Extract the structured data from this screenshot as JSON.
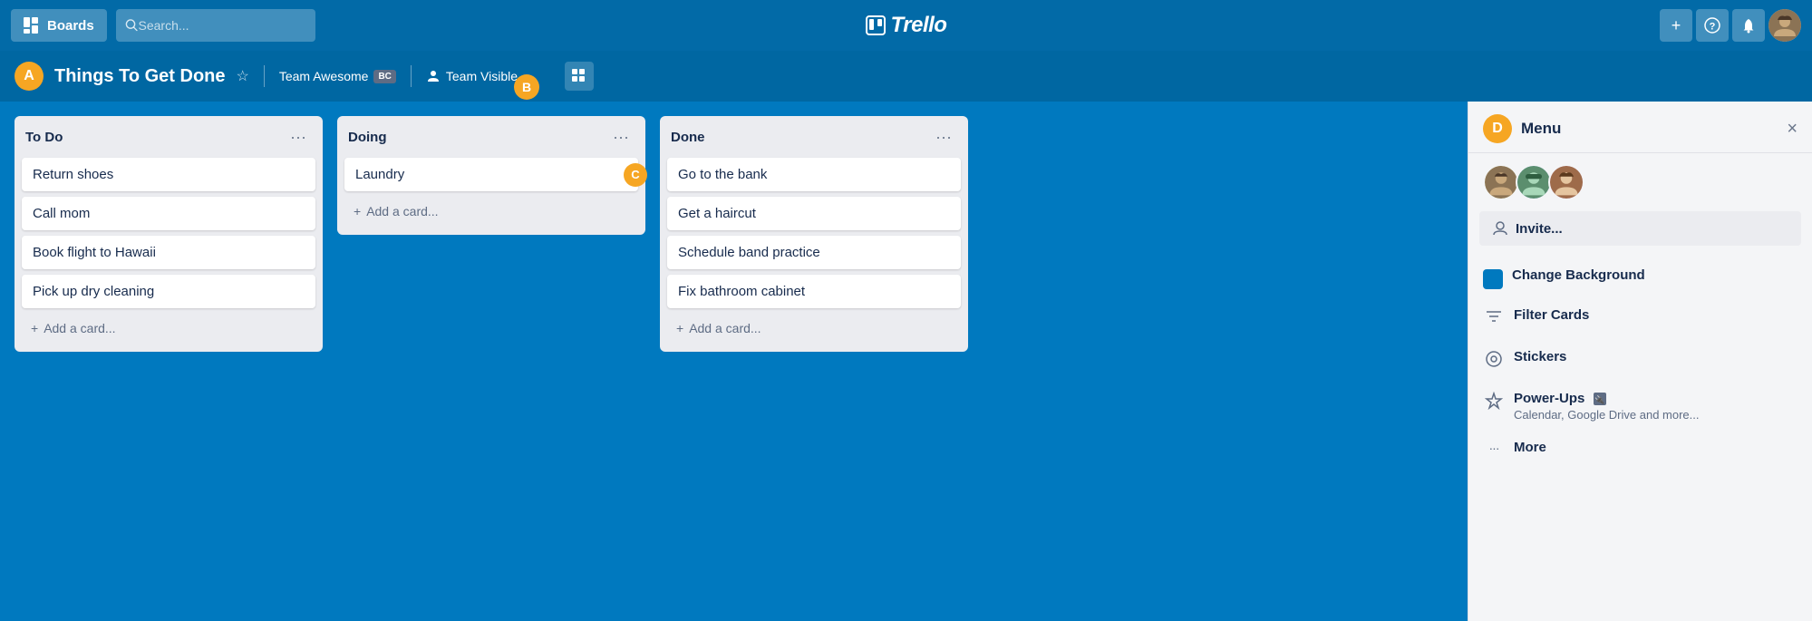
{
  "topnav": {
    "boards_label": "Boards",
    "search_placeholder": "Search...",
    "logo_text": "Trello",
    "add_label": "+",
    "info_label": "?",
    "notification_label": "🔔"
  },
  "board_header": {
    "label_a": "A",
    "title": "Things To Get Done",
    "team_name": "Team Awesome",
    "team_badge": "BC",
    "visibility_label": "Team Visible",
    "label_b": "B"
  },
  "lists": [
    {
      "id": "todo",
      "title": "To Do",
      "cards": [
        "Return shoes",
        "Call mom",
        "Book flight to Hawaii",
        "Pick up dry cleaning"
      ],
      "add_label": "Add a card..."
    },
    {
      "id": "doing",
      "title": "Doing",
      "cards": [
        "Laundry"
      ],
      "add_label": "Add a card...",
      "label_c": "C"
    },
    {
      "id": "done",
      "title": "Done",
      "cards": [
        "Go to the bank",
        "Get a haircut",
        "Schedule band practice",
        "Fix bathroom cabinet"
      ],
      "add_label": "Add a card..."
    }
  ],
  "menu": {
    "label_d": "D",
    "title": "Menu",
    "close_label": "×",
    "invite_label": "Invite...",
    "items": [
      {
        "id": "change-background",
        "label": "Change Background",
        "icon": "■",
        "is_color": true
      },
      {
        "id": "filter-cards",
        "label": "Filter Cards",
        "icon": "⊘"
      },
      {
        "id": "stickers",
        "label": "Stickers",
        "icon": "◎"
      },
      {
        "id": "power-ups",
        "label": "Power-Ups",
        "sub": "Calendar, Google Drive and more...",
        "icon": "⚡"
      },
      {
        "id": "more",
        "label": "More",
        "icon": "•••"
      }
    ]
  }
}
